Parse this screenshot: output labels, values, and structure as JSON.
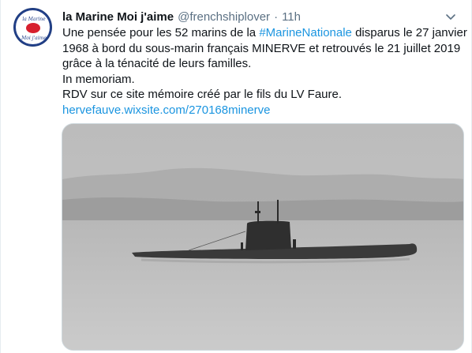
{
  "tweet": {
    "author_name": "la Marine Moi j'aime",
    "author_handle": "@frenchshiplover",
    "separator": "·",
    "time": "11h",
    "avatar_text_top": "la Marine",
    "avatar_text_bottom": "Moi j'aime",
    "lines": [
      {
        "pre": "Une pensée pour les 52 marins de la ",
        "hashtag": "#MarineNationale",
        "post": " disparus le 27 janvier"
      },
      {
        "text": "1968 à bord du sous-marin français MINERVE et retrouvés le 21 juillet 2019"
      },
      {
        "text": "grâce à la ténacité de leurs familles."
      },
      {
        "text": "In memoriam."
      },
      {
        "text": "RDV sur ce site mémoire créé par le fils du LV Faure."
      }
    ],
    "link": "hervefauve.wixsite.com/270168minerve",
    "more_icon": "chevron-down-icon",
    "image_icon": "submarine-photo"
  },
  "colors": {
    "link": "#1b95e0",
    "secondary_text": "#5b7083",
    "primary_text": "#0f1419",
    "avatar_blue": "#23418a",
    "avatar_red": "#d7202e"
  }
}
